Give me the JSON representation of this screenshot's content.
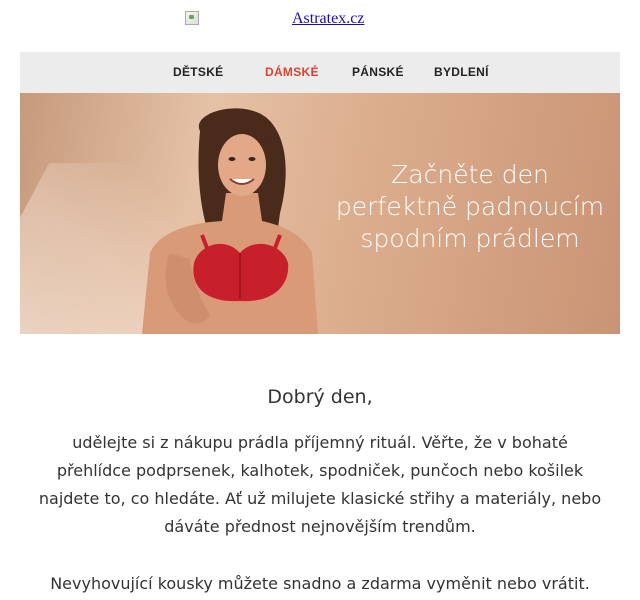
{
  "header": {
    "logo_alt": "Astratex.cz"
  },
  "nav": {
    "items": [
      {
        "label": "DĚTSKÉ",
        "active": false
      },
      {
        "label": "DÁMSKÉ",
        "active": true
      },
      {
        "label": "PÁNSKÉ",
        "active": false
      },
      {
        "label": "BYDLENÍ",
        "active": false
      }
    ],
    "active_color": "#d9432f"
  },
  "hero": {
    "headline_lines": [
      "Začněte den",
      "perfektně padnoucím",
      "spodním prádlem"
    ]
  },
  "content": {
    "greeting": "Dobrý den,",
    "paragraph_lines": [
      "udělejte si z nákupu prádla příjemný rituál. Věřte, že v bohaté",
      "přehlídce podprsenek, kalhotek, spodniček, punčoch nebo košilek",
      "najdete to, co hledáte. Ať už milujete klasické střihy a materiály, nebo",
      "dáváte přednost nejnovějším trendům."
    ],
    "paragraph2": "Nevyhovující kousky můžete snadno a zdarma vyměnit nebo vrátit."
  }
}
